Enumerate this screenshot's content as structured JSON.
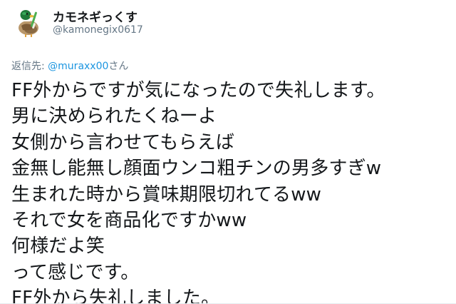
{
  "author": {
    "display_name": "カモネギっくす",
    "handle": "@kamonegix0617",
    "avatar_icon": "mallard-duck-avatar-icon"
  },
  "reply": {
    "prefix": "返信先: ",
    "mention": "@muraxx00",
    "suffix": "さん"
  },
  "tweet": {
    "lines": [
      "FF外からですが気になったので失礼します。",
      "男に決められたくねーよ",
      "女側から言わせてもらえば",
      "金無し能無し顔面ウンコ粗チンの男多すぎw",
      "生まれた時から賞味期限切れてるww",
      "それで女を商品化ですかww",
      "何様だよ笑",
      "って感じです。",
      "FF外から失礼しました。"
    ]
  },
  "colors": {
    "text_primary": "#14171a",
    "text_secondary": "#657786",
    "link": "#1b95e0"
  }
}
